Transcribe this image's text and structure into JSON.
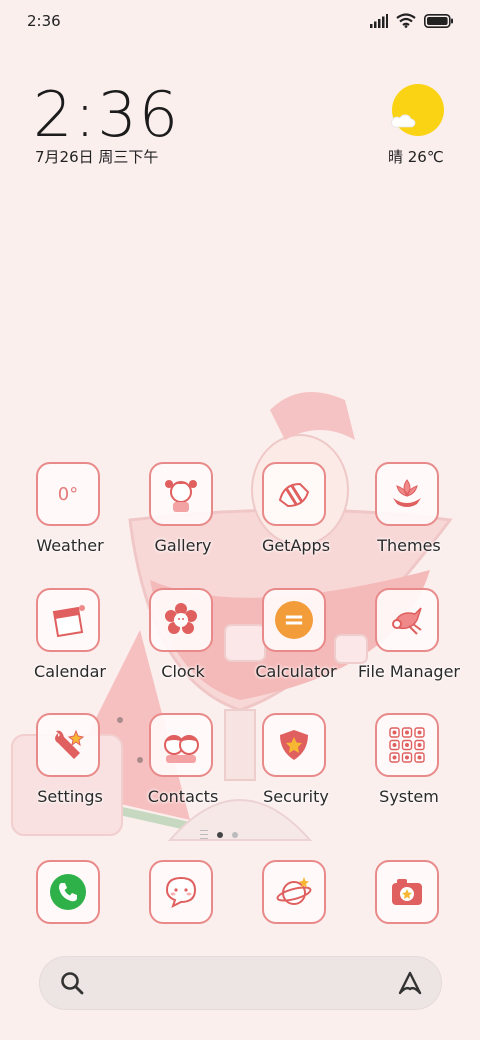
{
  "status_bar": {
    "time": "2:36",
    "icons": [
      "signal-icon",
      "wifi-icon",
      "battery-icon"
    ]
  },
  "clock_widget": {
    "time": "2:36",
    "date": "7月26日 周三下午"
  },
  "weather_widget": {
    "condition_temp": "晴 26℃",
    "icon": "sun-cloud-icon"
  },
  "apps": [
    {
      "label": "Weather",
      "icon": "weather-temperature-icon",
      "icon_text": "0°"
    },
    {
      "label": "Gallery",
      "icon": "gallery-girl-icon"
    },
    {
      "label": "GetApps",
      "icon": "getapps-icon"
    },
    {
      "label": "Themes",
      "icon": "themes-flower-icon"
    },
    {
      "label": "Calendar",
      "icon": "calendar-icon"
    },
    {
      "label": "Clock",
      "icon": "clock-flower-icon"
    },
    {
      "label": "Calculator",
      "icon": "calculator-icon",
      "icon_text": "="
    },
    {
      "label": "File Manager",
      "icon": "file-manager-icon"
    },
    {
      "label": "Settings",
      "icon": "settings-wrench-icon"
    },
    {
      "label": "Contacts",
      "icon": "contacts-icon"
    },
    {
      "label": "Security",
      "icon": "security-shield-icon"
    },
    {
      "label": "System",
      "icon": "system-folder-icon"
    }
  ],
  "dock": [
    {
      "icon": "phone-icon"
    },
    {
      "icon": "messages-icon"
    },
    {
      "icon": "browser-planet-icon"
    },
    {
      "icon": "camera-icon"
    }
  ],
  "page_indicator": {
    "pages": 2,
    "active": 1
  },
  "search_bar": {
    "placeholder": "",
    "left_icon": "search-icon",
    "right_icon": "assistant-icon"
  },
  "colors": {
    "accent": "#e98a8a",
    "background": "#fbefee",
    "sun": "#fbd315",
    "calculator": "#f39c3a",
    "phone": "#2fb14a"
  }
}
